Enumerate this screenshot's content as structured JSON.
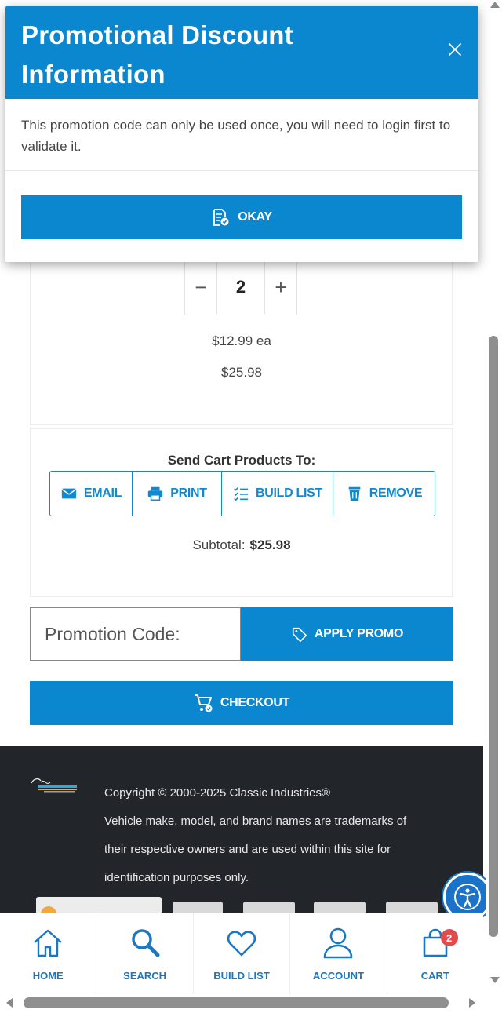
{
  "modal": {
    "title": "Promotional Discount Information",
    "message": "This promotion code can only be used once, you will need to login first to validate it.",
    "okay_label": "OKAY"
  },
  "cart_item": {
    "quantity": "2",
    "decrement": "−",
    "increment": "+",
    "unit_price": "$12.99 ea",
    "line_total": "$25.98"
  },
  "send_cart": {
    "title": "Send Cart Products To:",
    "actions": [
      {
        "label": "EMAIL",
        "icon": "envelope-icon"
      },
      {
        "label": "PRINT",
        "icon": "printer-icon"
      },
      {
        "label": "BUILD LIST",
        "icon": "checklist-icon"
      },
      {
        "label": "REMOVE",
        "icon": "trash-icon"
      }
    ],
    "subtotal_label": "Subtotal:",
    "subtotal_value": "$25.98"
  },
  "promo": {
    "placeholder": "Promotion Code:",
    "apply_label": "APPLY PROMO"
  },
  "checkout_label": "CHECKOUT",
  "footer": {
    "copyright": "Copyright © 2000-2025 Classic Industries®",
    "disclaimer": "Vehicle make, model, and brand names are trademarks of their respective owners and are used within this site for identification purposes only."
  },
  "bottom_nav": [
    {
      "label": "HOME",
      "icon": "home-icon"
    },
    {
      "label": "SEARCH",
      "icon": "search-icon"
    },
    {
      "label": "BUILD LIST",
      "icon": "heart-icon"
    },
    {
      "label": "ACCOUNT",
      "icon": "user-icon"
    },
    {
      "label": "CART",
      "icon": "cart-icon",
      "badge": "2"
    }
  ],
  "colors": {
    "primary": "#0b87d0",
    "footer_bg": "#222529",
    "badge": "#e24b4b",
    "nav_text": "#1c77c3"
  }
}
